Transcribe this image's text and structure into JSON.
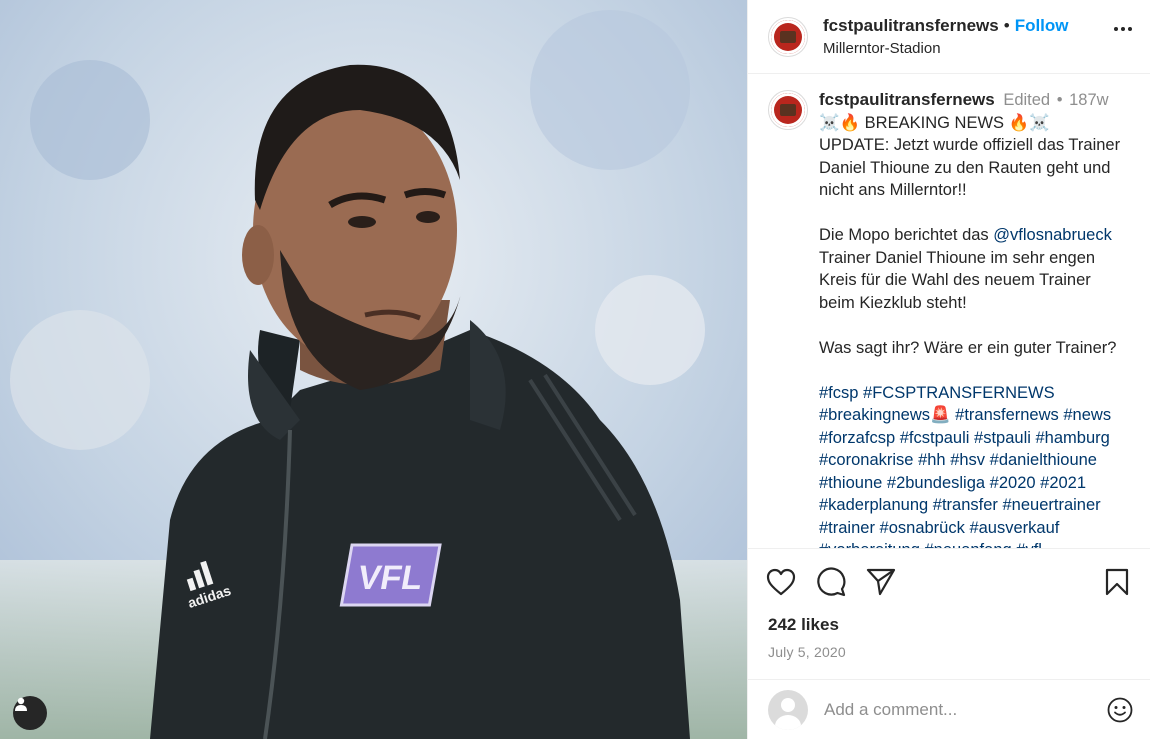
{
  "post": {
    "username": "fcstpaulitransfernews",
    "follow_label": "Follow",
    "dot": "•",
    "location": "Millerntor-Stadion",
    "media": {
      "jacket_logo_text": "VFL",
      "brand_text": "adidas"
    }
  },
  "caption": {
    "username": "fcstpaulitransfernews",
    "edited": "Edited",
    "separator": "•",
    "age": "187w",
    "headline": "☠️🔥 BREAKING NEWS 🔥☠️",
    "para1": "UPDATE: Jetzt wurde offiziell das Trainer Daniel Thioune zu den Rauten geht und nicht ans Millerntor!!",
    "para2_before": "Die Mopo berichtet das ",
    "para2_mention": "@vflosnabrueck",
    "para2_after": " Trainer Daniel Thioune im sehr engen Kreis für die Wahl des neuem Trainer beim Kiezklub steht!",
    "para3": "Was sagt ihr? Wäre er ein guter Trainer?",
    "hashtags": [
      "#fcsp",
      "#FCSPTRANSFERNEWS",
      "#breakingnews🚨",
      "#transfernews",
      "#news",
      "#forzafcsp",
      "#fcstpauli",
      "#stpauli",
      "#hamburg",
      "#coronakrise",
      "#hh",
      "#hsv",
      "#danielthioune",
      "#thioune",
      "#2bundesliga",
      "#2020",
      "#2021",
      "#kaderplanung",
      "#transfer",
      "#neuertrainer",
      "#trainer",
      "#osnabrück",
      "#ausverkauf",
      "#vorbereitung",
      "#neuanfang",
      "#vfl"
    ]
  },
  "stats": {
    "likes": "242 likes",
    "date": "July 5, 2020"
  },
  "comment": {
    "placeholder": "Add a comment..."
  },
  "icons": {
    "like": "heart-icon",
    "comment": "comment-icon",
    "share": "share-icon",
    "save": "bookmark-icon",
    "more": "more-icon",
    "emoji": "emoji-icon",
    "tags": "user-tag-icon"
  }
}
